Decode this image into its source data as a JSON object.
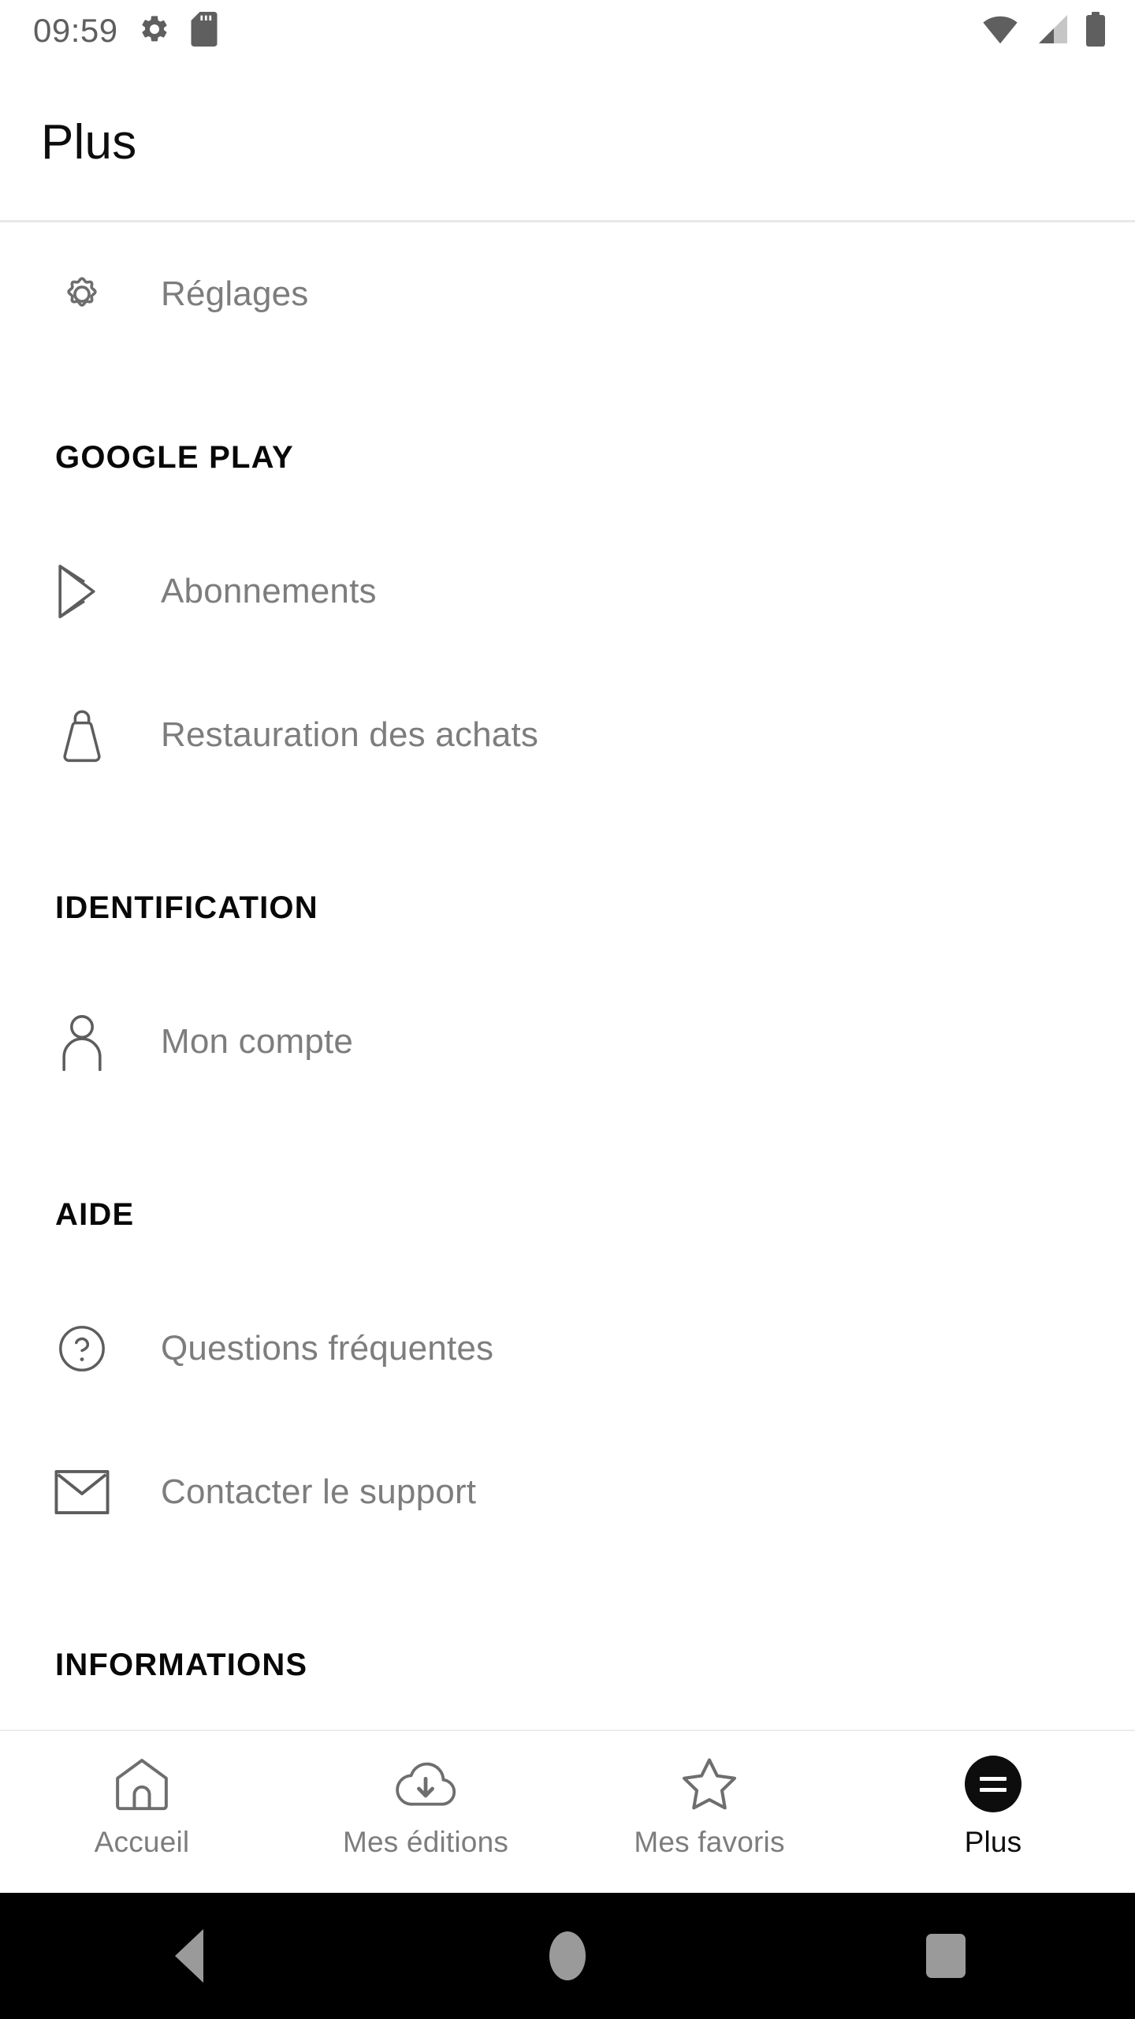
{
  "status_bar": {
    "time": "09:59",
    "icons": [
      "gear-icon",
      "sd-card-icon",
      "wifi-icon",
      "cellular-signal-icon",
      "battery-icon"
    ]
  },
  "app_bar": {
    "title": "Plus"
  },
  "content": {
    "top_items": [
      {
        "label": "Réglages",
        "icon": "gear-outline-icon"
      }
    ],
    "sections": [
      {
        "header": "GOOGLE PLAY",
        "items": [
          {
            "label": "Abonnements",
            "icon": "google-play-icon"
          },
          {
            "label": "Restauration des achats",
            "icon": "shopping-bag-icon"
          }
        ]
      },
      {
        "header": "IDENTIFICATION",
        "items": [
          {
            "label": "Mon compte",
            "icon": "person-icon"
          }
        ]
      },
      {
        "header": "AIDE",
        "items": [
          {
            "label": "Questions fréquentes",
            "icon": "help-circle-icon"
          },
          {
            "label": "Contacter le support",
            "icon": "envelope-icon"
          }
        ]
      },
      {
        "header": "INFORMATIONS",
        "items": []
      }
    ]
  },
  "tab_bar": {
    "tabs": [
      {
        "label": "Accueil",
        "icon": "home-icon",
        "active": false
      },
      {
        "label": "Mes éditions",
        "icon": "cloud-download-icon",
        "active": false
      },
      {
        "label": "Mes favoris",
        "icon": "star-icon",
        "active": false
      },
      {
        "label": "Plus",
        "icon": "menu-badge-icon",
        "active": true
      }
    ]
  },
  "nav_bar": {
    "buttons": [
      "back-button",
      "home-button",
      "recents-button"
    ]
  },
  "colors": {
    "text_primary": "#0d0d0d",
    "text_secondary": "#7d7d7d",
    "icon_stroke": "#6e6e6e",
    "divider": "#e8e8e8",
    "status_icon": "#5f5f5f",
    "nav_bar_bg": "#000000",
    "nav_icon": "#9a9a9a"
  }
}
